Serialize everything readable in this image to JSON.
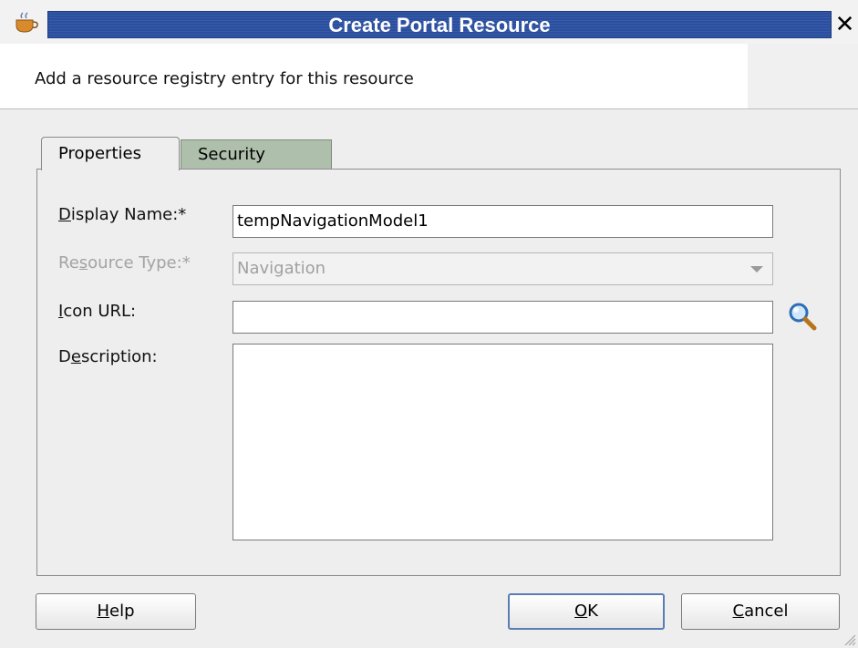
{
  "window": {
    "title": "Create Portal Resource",
    "close_glyph": "✕"
  },
  "banner": {
    "text": "Add a resource registry entry for this resource"
  },
  "tabs": [
    {
      "label": "Properties",
      "active": true
    },
    {
      "label": "Security",
      "active": false
    }
  ],
  "form": {
    "display_name": {
      "label_mn": "D",
      "label_rest": "isplay Name:*",
      "value": "tempNavigationModel1"
    },
    "resource_type": {
      "label_pre": "Re",
      "label_mn": "s",
      "label_rest": "ource Type:*",
      "value": "Navigation",
      "disabled": true
    },
    "icon_url": {
      "label_mn": "I",
      "label_rest": "con URL:",
      "value": ""
    },
    "description": {
      "label_pre": "D",
      "label_mn": "e",
      "label_rest": "scription:",
      "value": ""
    }
  },
  "buttons": {
    "help": {
      "mn": "H",
      "rest": "elp"
    },
    "ok": {
      "mn": "O",
      "rest": "K"
    },
    "cancel": {
      "mn": "C",
      "rest": "ancel"
    }
  },
  "icons": {
    "app": "java-cup-icon",
    "browse": "search-icon",
    "resize": "resize-grip-icon"
  },
  "colors": {
    "title_bar": "#2a4f9f",
    "security_tab": "#aebfab",
    "ok_border": "#5a7db8"
  }
}
